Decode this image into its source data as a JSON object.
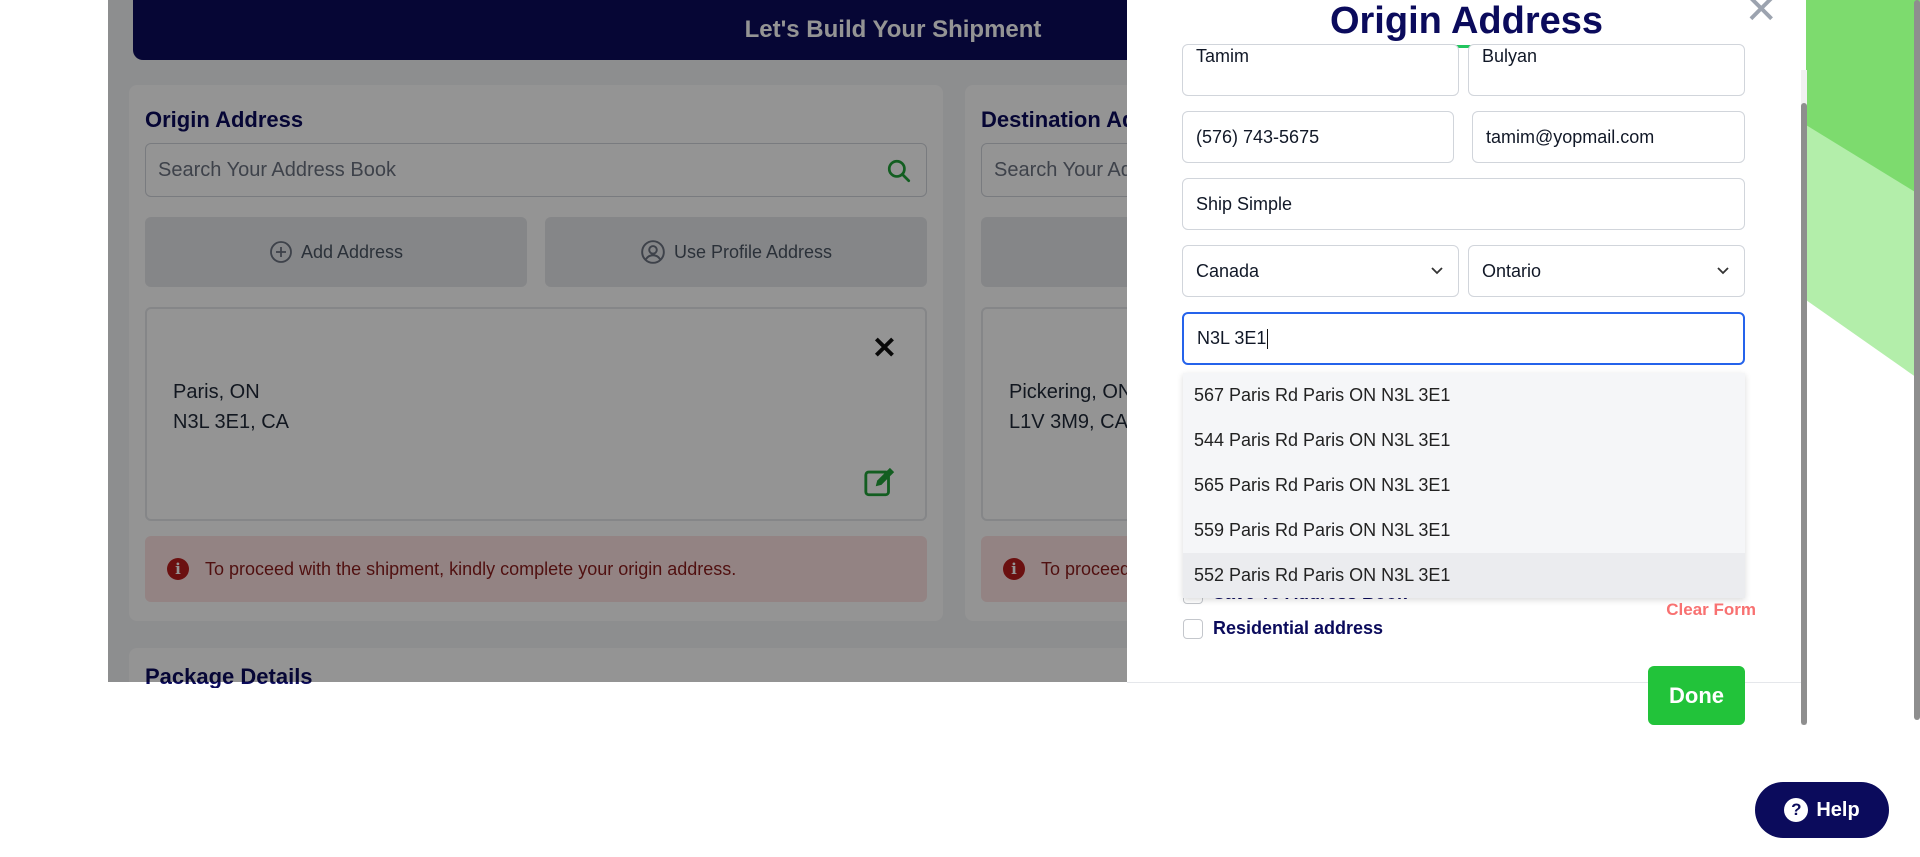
{
  "banner": {
    "title": "Let's Build Your Shipment"
  },
  "origin_panel": {
    "title": "Origin Address",
    "search_placeholder": "Search Your Address Book",
    "add_address_label": "Add Address",
    "use_profile_label": "Use Profile Address",
    "address_line1": "Paris, ON",
    "address_line2": "N3L 3E1, CA",
    "alert_text": "To proceed with the shipment, kindly complete your origin address."
  },
  "destination_panel": {
    "title": "Destination Ad",
    "search_placeholder": "Search Your Ad",
    "address_line1": "Pickering, ON",
    "address_line2": "L1V 3M9, CA",
    "alert_text": "To proceed"
  },
  "package_panel": {
    "title": "Package Details"
  },
  "modal": {
    "title": "Origin Address",
    "first_name": "Tamim",
    "last_name": "Bulyan",
    "phone": "(576) 743-5675",
    "email": "tamim@yopmail.com",
    "company": "Ship Simple",
    "country": "Canada",
    "province": "Ontario",
    "postal_input": "N3L 3E1",
    "suggestions": [
      "567 Paris Rd Paris ON N3L 3E1",
      "544 Paris Rd Paris ON N3L 3E1",
      "565 Paris Rd Paris ON N3L 3E1",
      "559 Paris Rd Paris ON N3L 3E1",
      "552 Paris Rd Paris ON N3L 3E1"
    ],
    "save_label": "Save To Address Book",
    "residential_label": "Residential address",
    "clear_form_label": "Clear Form",
    "done_label": "Done"
  },
  "help": {
    "label": "Help"
  },
  "colors": {
    "navy": "#0b0b5c",
    "green": "#22c33a",
    "alert_bg": "#fde2e2",
    "clear_form": "#f87171"
  }
}
